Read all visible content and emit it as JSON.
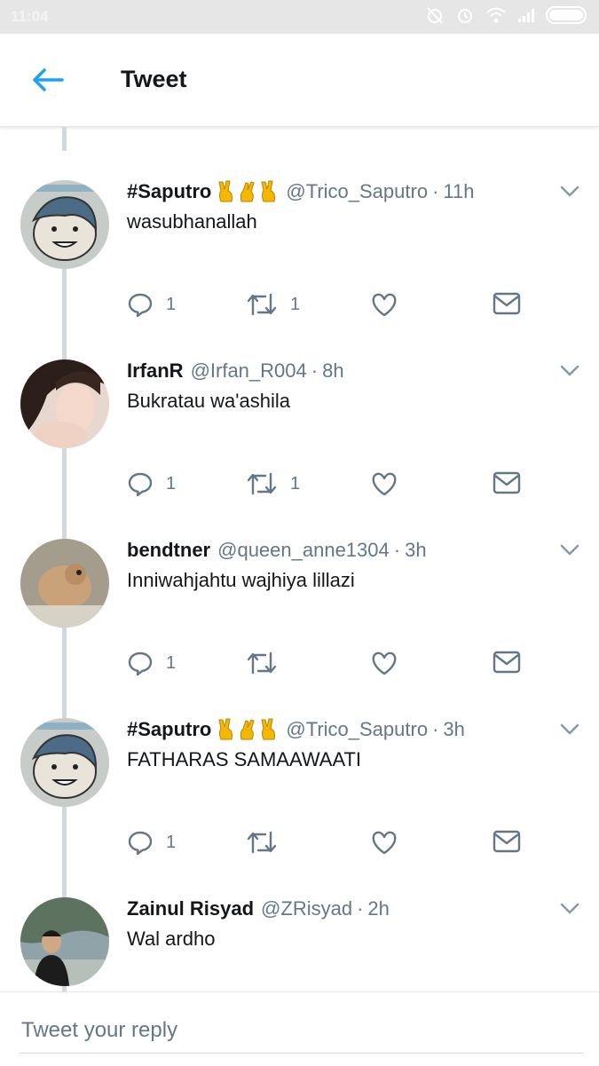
{
  "status_bar": {
    "time": "11:04"
  },
  "header": {
    "title": "Tweet"
  },
  "tweets": [
    {
      "name": "#Saputro",
      "emoji": "✌️🤞✌️",
      "handle": "@Trico_Saputro",
      "sep": "·",
      "time": "11h",
      "text": "wasubhanallah",
      "replies": "1",
      "retweets": "1",
      "likes": ""
    },
    {
      "name": "IrfanR",
      "emoji": "",
      "handle": "@Irfan_R004",
      "sep": "·",
      "time": "8h",
      "text": "Bukratau wa'ashila",
      "replies": "1",
      "retweets": "1",
      "likes": ""
    },
    {
      "name": "bendtner",
      "emoji": "",
      "handle": "@queen_anne1304",
      "sep": "·",
      "time": "3h",
      "text": "Inniwahjahtu wajhiya lillazi",
      "replies": "1",
      "retweets": "",
      "likes": ""
    },
    {
      "name": "#Saputro",
      "emoji": "✌️🤞✌️",
      "handle": "@Trico_Saputro",
      "sep": "·",
      "time": "3h",
      "text": "FATHARAS SAMAAWAATI",
      "replies": "1",
      "retweets": "",
      "likes": ""
    },
    {
      "name": "Zainul Risyad",
      "emoji": "",
      "handle": "@ZRisyad",
      "sep": "·",
      "time": "2h",
      "text": "Wal ardho",
      "replies": "",
      "retweets": "",
      "likes": ""
    }
  ],
  "reply": {
    "placeholder": "Tweet your reply"
  },
  "colors": {
    "accent": "#1da1f2",
    "secondary_text": "#657786",
    "thread_line": "#cfd9de"
  }
}
